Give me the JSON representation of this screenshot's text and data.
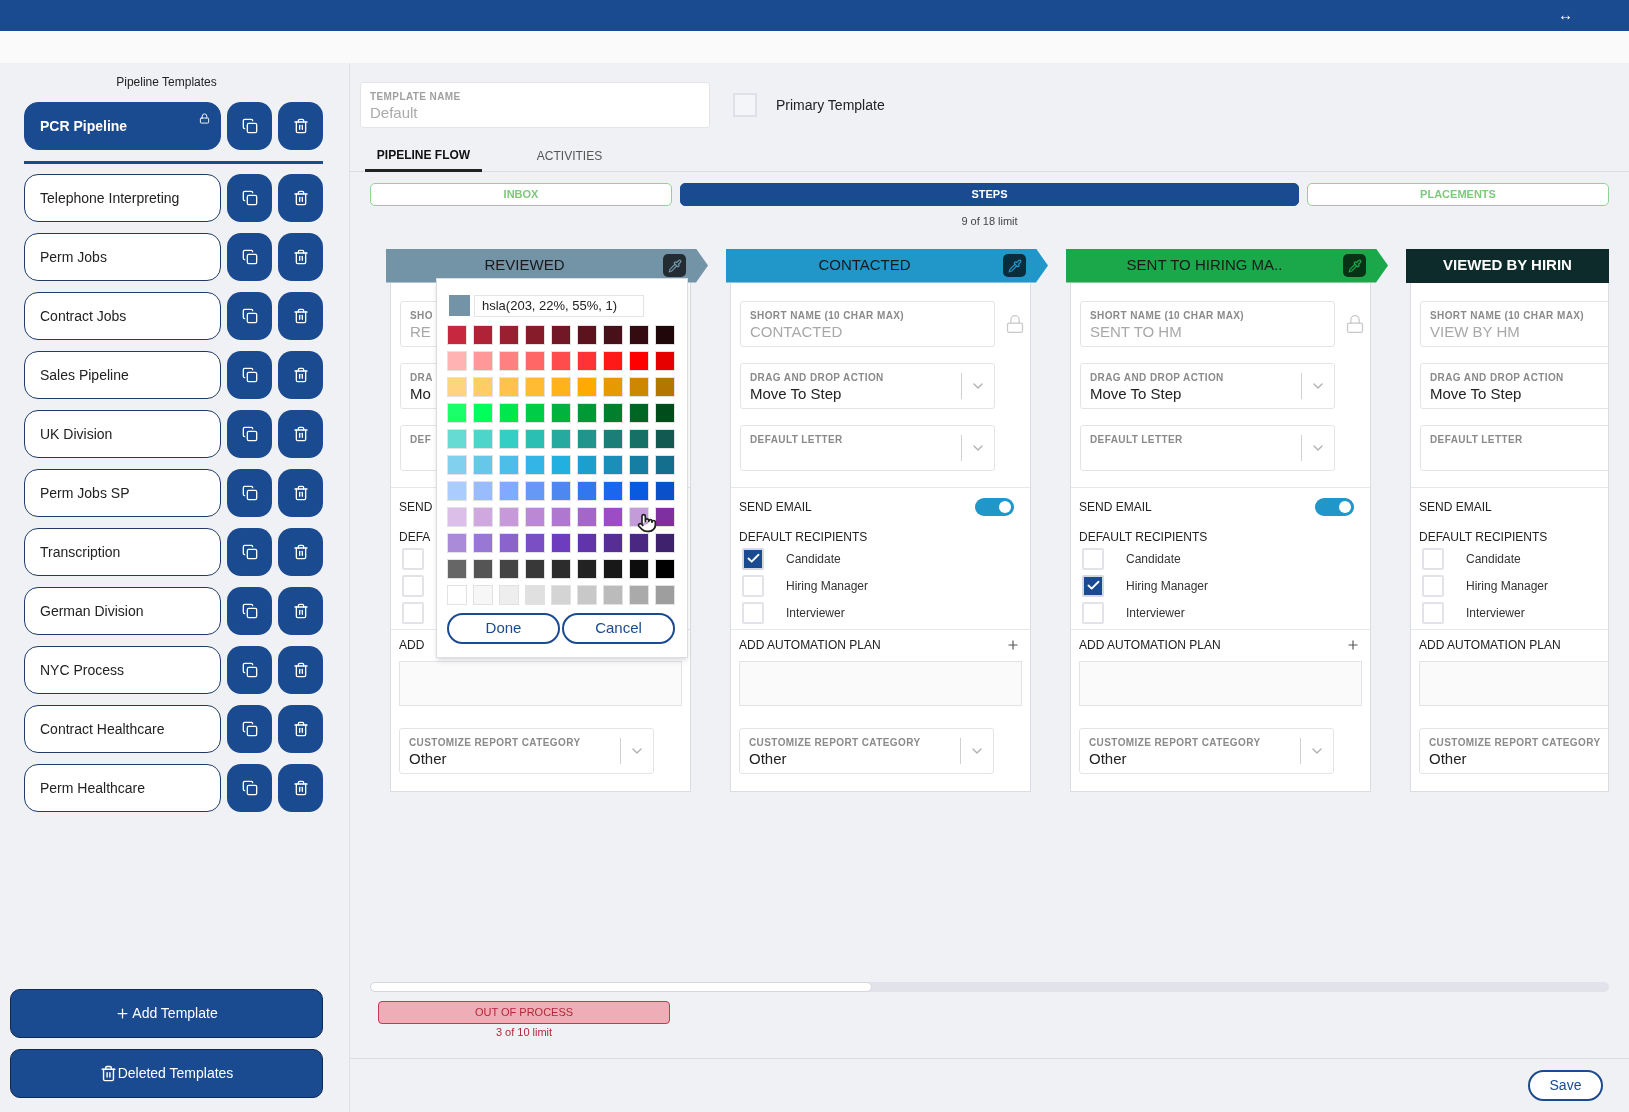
{
  "top_bar": {
    "icon": "↔"
  },
  "sidebar": {
    "title": "Pipeline Templates",
    "templates": [
      {
        "name": "PCR Pipeline",
        "selected": true,
        "locked": true
      },
      {
        "name": "Telephone Interpreting",
        "selected": false
      },
      {
        "name": "Perm Jobs",
        "selected": false
      },
      {
        "name": "Contract Jobs",
        "selected": false
      },
      {
        "name": "Sales Pipeline",
        "selected": false
      },
      {
        "name": "UK Division",
        "selected": false
      },
      {
        "name": "Perm Jobs SP",
        "selected": false
      },
      {
        "name": "Transcription",
        "selected": false
      },
      {
        "name": "German Division",
        "selected": false
      },
      {
        "name": "NYC Process",
        "selected": false
      },
      {
        "name": "Contract Healthcare",
        "selected": false
      },
      {
        "name": "Perm Healthcare",
        "selected": false
      }
    ],
    "add_button": "Add Template",
    "deleted_button": "Deleted Templates"
  },
  "template_name": {
    "label": "TEMPLATE NAME",
    "placeholder": "Default"
  },
  "primary_template": {
    "label": "Primary Template",
    "checked": false
  },
  "tabs": [
    {
      "label": "PIPELINE FLOW",
      "selected": true
    },
    {
      "label": "ACTIVITIES",
      "selected": false
    }
  ],
  "stages": [
    {
      "label": "INBOX",
      "selected": false
    },
    {
      "label": "STEPS",
      "selected": true
    },
    {
      "label": "PLACEMENTS",
      "selected": false
    }
  ],
  "steps_limit": "9 of 18 limit",
  "steps": [
    {
      "title": "REVIEWED",
      "color": "#7393a7",
      "eyedropper": true,
      "picker_open": true,
      "short_name_label": "SHO",
      "short_name": "RE",
      "drag_label": "DRA",
      "drag_value": "Mo",
      "letter_label": "DEF",
      "send_email_label": "SEND",
      "recipients_label": "DEFA",
      "recipients": [
        {
          "checked": false
        },
        {
          "checked": false
        },
        {
          "checked": false
        }
      ],
      "automation_label": "ADD",
      "category_label": "CUSTOMIZE REPORT CATEGORY",
      "category_value": "Other"
    },
    {
      "title": "CONTACTED",
      "color": "#2196c9",
      "eyedropper": true,
      "locked": true,
      "short_name_label": "SHORT NAME (10 CHAR MAX)",
      "short_name": "CONTACTED",
      "drag_label": "DRAG AND DROP ACTION",
      "drag_value": "Move To Step",
      "letter_label": "DEFAULT LETTER",
      "send_email_label": "SEND EMAIL",
      "send_email": true,
      "recipients_label": "DEFAULT RECIPIENTS",
      "recipients": [
        {
          "label": "Candidate",
          "checked": true
        },
        {
          "label": "Hiring Manager",
          "checked": false
        },
        {
          "label": "Interviewer",
          "checked": false
        }
      ],
      "automation_label": "ADD AUTOMATION PLAN",
      "category_label": "CUSTOMIZE REPORT CATEGORY",
      "category_value": "Other"
    },
    {
      "title": "SENT TO HIRING MA..",
      "color": "#1aa84b",
      "eyedropper": true,
      "locked": true,
      "short_name_label": "SHORT NAME (10 CHAR MAX)",
      "short_name": "SENT TO HM",
      "drag_label": "DRAG AND DROP ACTION",
      "drag_value": "Move To Step",
      "letter_label": "DEFAULT LETTER",
      "send_email_label": "SEND EMAIL",
      "send_email": true,
      "recipients_label": "DEFAULT RECIPIENTS",
      "recipients": [
        {
          "label": "Candidate",
          "checked": false
        },
        {
          "label": "Hiring Manager",
          "checked": true
        },
        {
          "label": "Interviewer",
          "checked": false
        }
      ],
      "automation_label": "ADD AUTOMATION PLAN",
      "category_label": "CUSTOMIZE REPORT CATEGORY",
      "category_value": "Other"
    },
    {
      "title": "VIEWED BY HIRIN",
      "color": "#0d2b2b",
      "short_name_label": "SHORT NAME (10 CHAR MAX)",
      "short_name": "VIEW BY HM",
      "drag_label": "DRAG AND DROP ACTION",
      "drag_value": "Move To Step",
      "letter_label": "DEFAULT LETTER",
      "send_email_label": "SEND EMAIL",
      "recipients_label": "DEFAULT RECIPIENTS",
      "recipients": [
        {
          "label": "Candidate",
          "checked": false
        },
        {
          "label": "Hiring Manager",
          "checked": false
        },
        {
          "label": "Interviewer",
          "checked": false
        }
      ],
      "automation_label": "ADD AUTOMATION PLAN",
      "category_label": "CUSTOMIZE REPORT CATEGORY",
      "category_value": "Other"
    }
  ],
  "color_picker": {
    "preview": {
      "color": "#7393a7"
    },
    "value": "hsla(203, 22%, 55%, 1)",
    "done": "Done",
    "cancel": "Cancel",
    "palette": [
      [
        {
          "color": "#c8283f"
        },
        {
          "color": "#b02337"
        },
        {
          "color": "#9a1f30"
        },
        {
          "color": "#861b2a"
        },
        {
          "color": "#711725"
        },
        {
          "color": "#5c131e"
        },
        {
          "color": "#481018"
        },
        {
          "color": "#330b11"
        },
        {
          "color": "#1f070a"
        }
      ],
      [
        {
          "color": "#ffb3b3"
        },
        {
          "color": "#ff9999"
        },
        {
          "color": "#ff8080"
        },
        {
          "color": "#ff6666"
        },
        {
          "color": "#ff4d4d"
        },
        {
          "color": "#ff3333"
        },
        {
          "color": "#ff1a1a"
        },
        {
          "color": "#ff0000"
        },
        {
          "color": "#e60000"
        }
      ],
      [
        {
          "color": "#ffd480"
        },
        {
          "color": "#ffcc66"
        },
        {
          "color": "#ffc34d"
        },
        {
          "color": "#ffbb33"
        },
        {
          "color": "#ffb31a"
        },
        {
          "color": "#ffaa00"
        },
        {
          "color": "#e69900"
        },
        {
          "color": "#cc8800"
        },
        {
          "color": "#b37700"
        }
      ],
      [
        {
          "color": "#1aff6a"
        },
        {
          "color": "#00ff5a"
        },
        {
          "color": "#00e64f"
        },
        {
          "color": "#00cc47"
        },
        {
          "color": "#00b33e"
        },
        {
          "color": "#009935"
        },
        {
          "color": "#00802d"
        },
        {
          "color": "#006624"
        },
        {
          "color": "#004d1b"
        }
      ],
      [
        {
          "color": "#66dbd3"
        },
        {
          "color": "#4dd5cc"
        },
        {
          "color": "#33cfc4"
        },
        {
          "color": "#2bbfb4"
        },
        {
          "color": "#26a99f"
        },
        {
          "color": "#21948b"
        },
        {
          "color": "#1c7f77"
        },
        {
          "color": "#177065"
        },
        {
          "color": "#125952"
        }
      ],
      [
        {
          "color": "#80d0ee"
        },
        {
          "color": "#66c7eb"
        },
        {
          "color": "#4dbee8"
        },
        {
          "color": "#33b5e5"
        },
        {
          "color": "#22b0e0"
        },
        {
          "color": "#1d9fcd"
        },
        {
          "color": "#1a8fb8"
        },
        {
          "color": "#177ea3"
        },
        {
          "color": "#146e8e"
        }
      ],
      [
        {
          "color": "#aaccff"
        },
        {
          "color": "#99bbff"
        },
        {
          "color": "#80aaff"
        },
        {
          "color": "#6699f5"
        },
        {
          "color": "#4d88f0"
        },
        {
          "color": "#3377ee"
        },
        {
          "color": "#1a66ee"
        },
        {
          "color": "#0a5ae0"
        },
        {
          "color": "#0a50c8"
        }
      ],
      [
        {
          "color": "#dcbfe8"
        },
        {
          "color": "#d0a8e0"
        },
        {
          "color": "#c699d9"
        },
        {
          "color": "#bb88d4"
        },
        {
          "color": "#b077cf"
        },
        {
          "color": "#a466c9"
        },
        {
          "color": "#9b4dc7"
        },
        {
          "color": "#c49bd9"
        },
        {
          "color": "#7e30a0"
        }
      ],
      [
        {
          "color": "#a98bd9"
        },
        {
          "color": "#9977d4"
        },
        {
          "color": "#8a63cc"
        },
        {
          "color": "#7b4fc4"
        },
        {
          "color": "#6e3cbf"
        },
        {
          "color": "#6234aa"
        },
        {
          "color": "#562e96"
        },
        {
          "color": "#4a2882"
        },
        {
          "color": "#3e226e"
        }
      ],
      [
        {
          "color": "#666666"
        },
        {
          "color": "#555555"
        },
        {
          "color": "#444444"
        },
        {
          "color": "#383838"
        },
        {
          "color": "#2c2c2c"
        },
        {
          "color": "#222222"
        },
        {
          "color": "#181818"
        },
        {
          "color": "#0d0d0d"
        },
        {
          "color": "#000000"
        }
      ],
      [
        {
          "color": "#ffffff"
        },
        {
          "color": "#f7f7f7"
        },
        {
          "color": "#eeeeee"
        },
        {
          "color": "#e0e0e0"
        },
        {
          "color": "#d4d4d4"
        },
        {
          "color": "#c8c8c8"
        },
        {
          "color": "#bbbbbb"
        },
        {
          "color": "#aaaaaa"
        },
        {
          "color": "#9e9e9e"
        }
      ]
    ]
  },
  "out_of_process": {
    "label": "OUT OF PROCESS",
    "limit": "3 of 10 limit"
  },
  "save_button": "Save"
}
